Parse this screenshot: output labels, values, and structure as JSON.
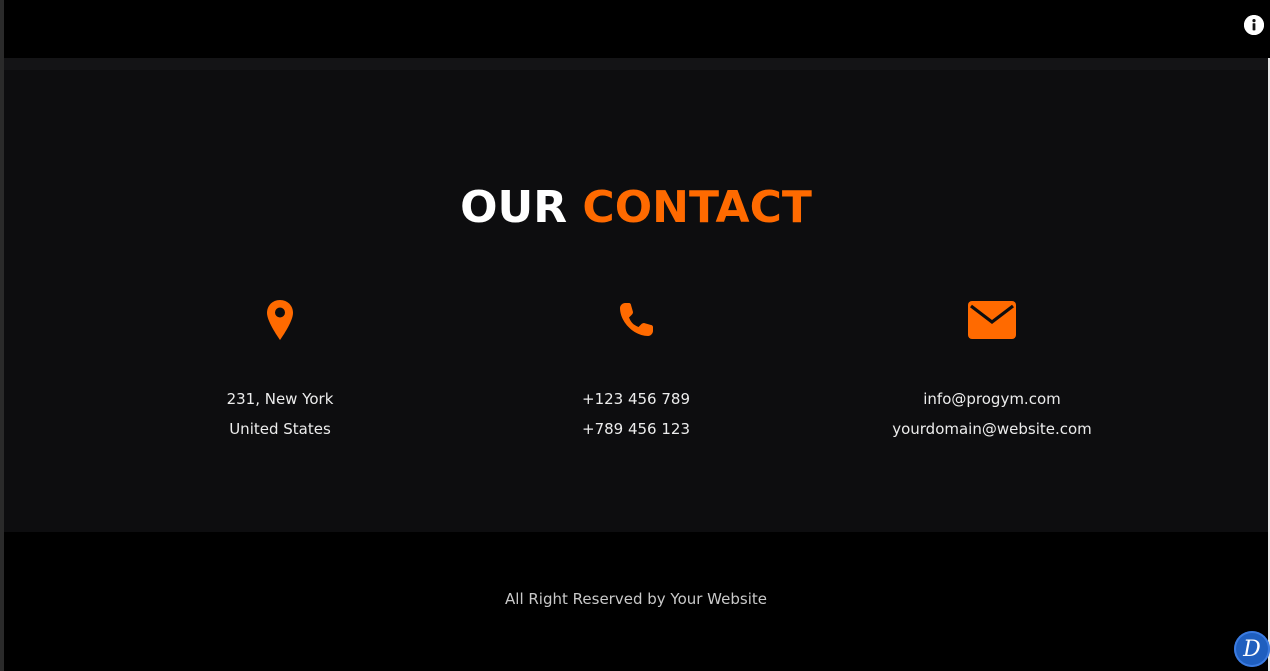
{
  "header": {
    "info_icon": "info-icon"
  },
  "contact": {
    "title_part1": "OUR",
    "title_part2": "CONTACT",
    "accent_color": "#ff6a00",
    "columns": [
      {
        "icon": "location-pin-icon",
        "line1": "231, New York",
        "line2": "United States"
      },
      {
        "icon": "phone-icon",
        "line1": "+123 456 789",
        "line2": "+789 456 123"
      },
      {
        "icon": "envelope-icon",
        "line1": "info@progym.com",
        "line2": "yourdomain@website.com"
      }
    ]
  },
  "footer": {
    "copyright": "All Right Reserved by Your Website"
  },
  "badge": {
    "letter": "D"
  }
}
